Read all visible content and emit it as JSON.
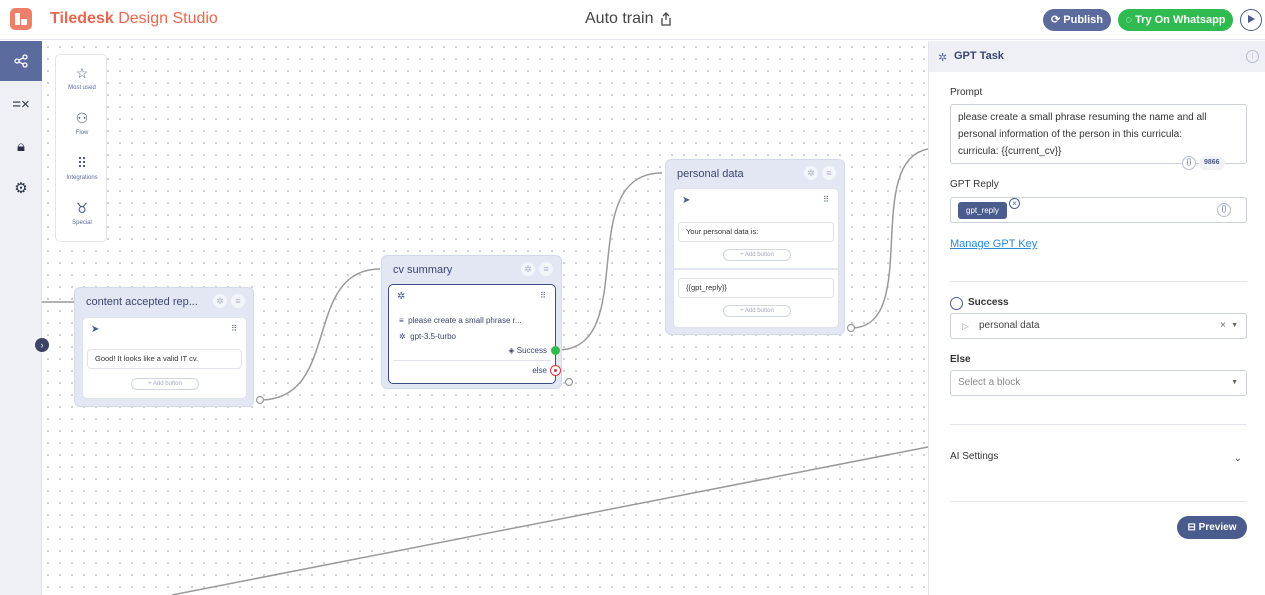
{
  "header": {
    "brand_bold": "Tiledesk",
    "brand_rest": "Design Studio",
    "title": "Auto train",
    "publish_label": "Publish",
    "whatsapp_label": "Try On Whatsapp"
  },
  "rail": {
    "items": [
      "flow-icon",
      "intents-icon",
      "lock-icon",
      "settings-icon"
    ]
  },
  "palette": {
    "items": [
      {
        "label": "Most used",
        "icon": "star-icon"
      },
      {
        "label": "Flow",
        "icon": "flow-icon"
      },
      {
        "label": "Integrations",
        "icon": "grid-icon"
      },
      {
        "label": "Special",
        "icon": "special-icon"
      }
    ]
  },
  "blocks": {
    "content": {
      "title": "content accepted rep...",
      "message": "Good! It looks like a valid IT cv.",
      "add_button": "+ Add button"
    },
    "cv": {
      "title": "cv summary",
      "prompt": "please create a small phrase r...",
      "model": "gpt-3.5-turbo",
      "success": "Success",
      "else": "else"
    },
    "personal": {
      "title": "personal data",
      "message1": "Your personal data is:",
      "message2": "{{gpt_reply}}",
      "add_button": "+ Add button"
    }
  },
  "panel": {
    "title": "GPT Task",
    "prompt_label": "Prompt",
    "prompt_line1": "please create a small phrase resuming the name and all",
    "prompt_line2": "personal information of the person in this curricula:",
    "prompt_line3": "curricula: {{current_cv}}",
    "char_count": "9866",
    "reply_label": "GPT Reply",
    "reply_chip": "gpt_reply",
    "manage_link": "Manage GPT Key",
    "success_label": "Success",
    "success_value": "personal data",
    "else_label": "Else",
    "else_placeholder": "Select a block",
    "ai_settings_label": "AI Settings",
    "preview_label": "Preview"
  },
  "colors": {
    "brand": "#e8674f",
    "accent": "#4a5b8e",
    "whatsapp": "#2fbb4f",
    "success_port": "#2fbb4f",
    "else_port": "#d9343a"
  }
}
